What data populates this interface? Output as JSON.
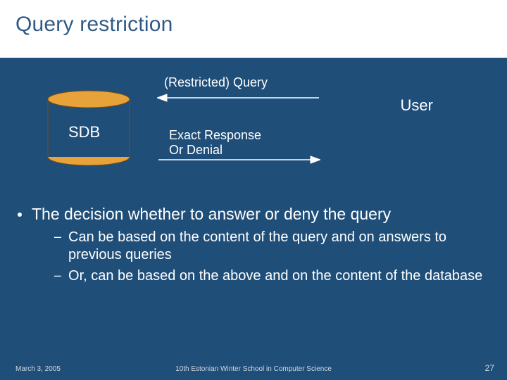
{
  "title": "Query restriction",
  "diagram": {
    "query_label": "(Restricted) Query",
    "user_label": "User",
    "response_label_line1": "Exact Response",
    "response_label_line2": "Or Denial",
    "sdb_label": "SDB"
  },
  "bullets": {
    "main": "The decision whether to answer or deny the query",
    "sub1": "Can be based on the content of the query and on answers to  previous queries",
    "sub2": "Or, can be based on the above and on the content of the database"
  },
  "footer": {
    "date": "March 3, 2005",
    "center": "10th Estonian Winter School in Computer Science",
    "page": "27"
  }
}
